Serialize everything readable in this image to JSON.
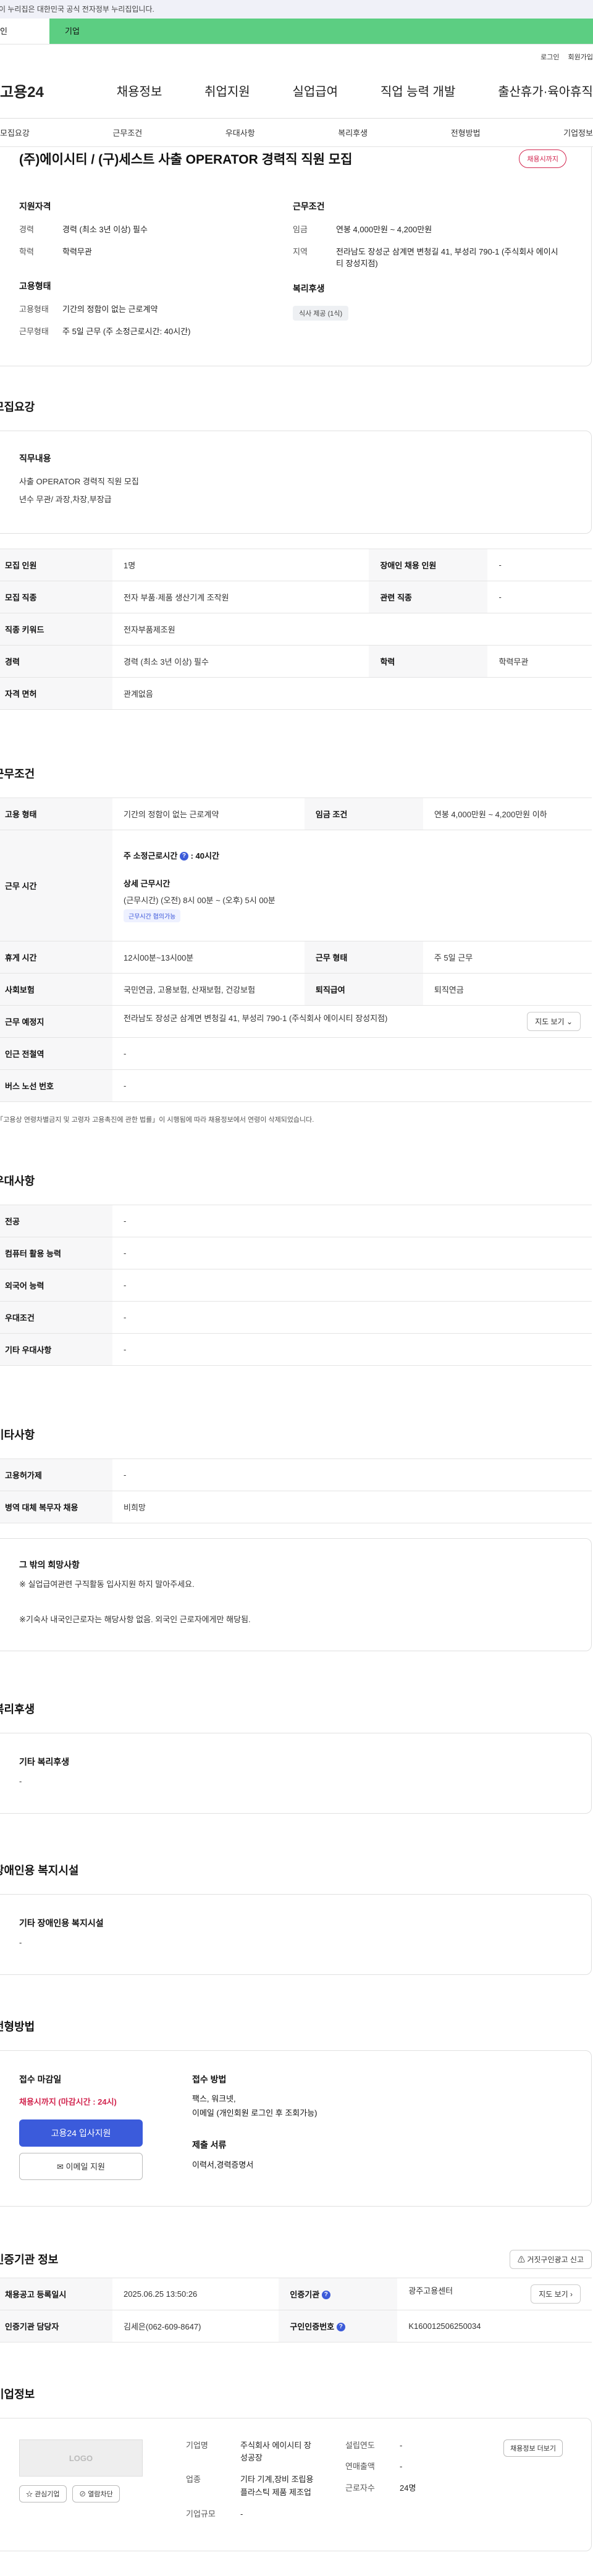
{
  "gov_banner": "이 누리집은 대한민국 공식 전자정부 누리집입니다.",
  "tabs": {
    "person": "개인",
    "company": "기업"
  },
  "util": {
    "login": "로그인",
    "signup": "회원가입"
  },
  "gnb": {
    "logo": "고용24",
    "items": [
      "채용정보",
      "취업지원",
      "실업급여",
      "직업 능력 개발",
      "출산휴가·육아휴직"
    ]
  },
  "subnav": [
    "모집요강",
    "근무조건",
    "우대사항",
    "복리후생",
    "전형방법",
    "기업정보"
  ],
  "job": {
    "title": "(주)에이시티 / (구)세스트 사출 OPERATOR 경력직 직원 모집",
    "deadline_badge": "채용시까지",
    "summary": {
      "qual_title": "지원자격",
      "career_k": "경력",
      "career_v": "경력 (최소 3년 이상) 필수",
      "edu_k": "학력",
      "edu_v": "학력무관",
      "cond_title": "근무조건",
      "wage_k": "임금",
      "wage_v": "연봉 4,000만원 ~ 4,200만원",
      "loc_k": "지역",
      "loc_v": "전라남도 장성군 삼계면 변청길 41, 부성리 790-1 (주식회사 에이시티 장성지점)",
      "emp_title": "고용형태",
      "emptype_k": "고용형태",
      "emptype_v": "기간의 정함이 없는 근로계약",
      "worktype_k": "근무형태",
      "worktype_v": "주 5일 근무 (주 소정근로시간: 40시간)",
      "welfare_title": "복리후생",
      "welfare_tag": "식사 제공 (1식)"
    }
  },
  "recruit": {
    "heading": "모집요강",
    "duty_title": "직무내용",
    "duty_lines": [
      "사출 OPERATOR 경력직 직원 모집",
      "년수 무관/ 과장,차장,부장급"
    ],
    "rows": [
      {
        "k1": "모집 인원",
        "v1": "1명",
        "k2": "장애인 채용 인원",
        "v2": "-"
      },
      {
        "k1": "모집 직종",
        "v1": "전자 부품·제품 생산기계 조작원",
        "k2": "관련 직종",
        "v2": "-"
      },
      {
        "k1": "직종 키워드",
        "v1": "전자부품제조원"
      },
      {
        "k1": "경력",
        "v1": "경력 (최소 3년 이상) 필수",
        "k2": "학력",
        "v2": "학력무관"
      },
      {
        "k1": "자격 면허",
        "v1": "관계없음"
      }
    ]
  },
  "conditions": {
    "heading": "근무조건",
    "employ_k": "고용 형태",
    "employ_v": "기간의 정함이 없는 근로계약",
    "wage_k": "임금 조건",
    "wage_v": "연봉 4,000만원 ~ 4,200만원 이하",
    "time_k": "근무 시간",
    "time_std": "주 소정근로시간",
    "time_std_v": ": 40시간",
    "time_detail_title": "상세 근무시간",
    "time_detail": "(근무시간) (오전) 8시 00분 ~ (오후) 5시 00분",
    "hire_pill": "근무시간 협의가능",
    "break_k": "휴게 시간",
    "break_v": "12시00분~13시00분",
    "shape_k": "근무 형태",
    "shape_v": "주 5일 근무",
    "ins_k": "사회보험",
    "ins_v": "국민연금, 고용보험, 산재보험, 건강보험",
    "retire_k": "퇴직급여",
    "retire_v": "퇴직연금",
    "place_k": "근무 예정지",
    "place_v": "전라남도 장성군 삼계면 변청길 41, 부성리 790-1 (주식회사 에이시티 장성지점)",
    "map_btn": "지도 보기",
    "subway_k": "인근 전철역",
    "subway_v": "-",
    "bus_k": "버스 노선 번호",
    "bus_v": "-",
    "note": "*「고용상 연령차별금지 및 고령자 고용촉진에 관한 법률」이 시행됨에 따라 채용정보에서 연령이 삭제되었습니다."
  },
  "pref": {
    "heading": "우대사항",
    "rows": [
      {
        "k": "전공",
        "v": "-"
      },
      {
        "k": "컴퓨터 활용 능력",
        "v": "-"
      },
      {
        "k": "외국어 능력",
        "v": "-"
      },
      {
        "k": "우대조건",
        "v": "-"
      },
      {
        "k": "기타 우대사항",
        "v": "-"
      }
    ]
  },
  "etc": {
    "heading": "기타사항",
    "rows": [
      {
        "k": "고용허가제",
        "v": "-"
      },
      {
        "k": "병역 대체 복무자 채용",
        "v": "비희망"
      }
    ],
    "box_title": "그 밖의 희망사항",
    "box_lines": [
      "※ 실업급여관련 구직활동 입사지원 하지 말아주세요.",
      "",
      "※기숙사 내국인근로자는 해당사항 없음. 외국인 근로자에게만 해당됨."
    ]
  },
  "welfare": {
    "heading": "복리후생",
    "box_title": "기타 복리후생",
    "box_value": "-"
  },
  "disabled": {
    "heading": "장애인용 복지시설",
    "box_title": "기타 장애인용 복지시설",
    "box_value": "-"
  },
  "selection": {
    "heading": "전형방법",
    "deadline_title": "접수 마감일",
    "deadline_value": "채용시까지 (마감시간 : 24시)",
    "apply_btn": "고용24 입사지원",
    "email_btn": "이메일 지원",
    "method_title": "접수 방법",
    "method_value": "팩스, 워크넷,",
    "method_value2": "이메일 (개인회원 로그인 후 조회가능)",
    "docs_title": "제출 서류",
    "docs_value": "이력서,경력증명서"
  },
  "agency": {
    "heading": "인증기관 정보",
    "report_btn": "거짓구인광고 신고",
    "reg_k": "채용공고 등록일시",
    "reg_v": "2025.06.25 13:50:26",
    "org_k": "인증기관",
    "org_v": "광주고용센터",
    "map_btn": "지도 보기",
    "mgr_k": "인증기관 담당자",
    "mgr_v": "김세은(062-609-8647)",
    "num_k": "구인인증번호",
    "num_v": "K160012506250034"
  },
  "company": {
    "heading": "기업정보",
    "logo": "LOGO",
    "fav_btn": "관심기업",
    "block_btn": "열람차단",
    "name_k": "기업명",
    "name_v": "주식회사 에이시티 장성공장",
    "biz_k": "업종",
    "biz_v": "기타 기계,장비 조립용 플라스틱 제품 제조업",
    "size_k": "기업규모",
    "size_v": "-",
    "year_k": "설립연도",
    "year_v": "-",
    "sales_k": "연매출액",
    "sales_v": "-",
    "emp_k": "근로자수",
    "emp_v": "24명",
    "info_btn": "채용정보 더보기"
  }
}
